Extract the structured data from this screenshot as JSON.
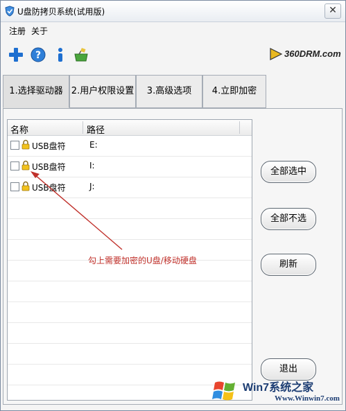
{
  "window": {
    "title": "U盘防拷贝系统(试用版)",
    "close_glyph": "✕"
  },
  "menu": {
    "items": [
      {
        "label": "注册"
      },
      {
        "label": "关于"
      }
    ]
  },
  "toolbar": {
    "icons": [
      "add-icon",
      "help-icon",
      "info-icon",
      "basket-icon"
    ]
  },
  "brand": {
    "text": "360DRM.com"
  },
  "tabs": [
    {
      "label": "1.选择驱动器",
      "active": true
    },
    {
      "label": "2.用户权限设置",
      "active": false
    },
    {
      "label": "3.高级选项",
      "active": false
    },
    {
      "label": "4.立即加密",
      "active": false
    }
  ],
  "drive_list": {
    "columns": {
      "name": "名称",
      "path": "路径"
    },
    "rows": [
      {
        "name": "USB盘符",
        "path": "E:",
        "checked": false
      },
      {
        "name": "USB盘符",
        "path": "I:",
        "checked": false
      },
      {
        "name": "USB盘符",
        "path": "J:",
        "checked": false
      }
    ]
  },
  "buttons": {
    "select_all": "全部选中",
    "select_none": "全部不选",
    "refresh": "刷新",
    "exit": "退出"
  },
  "annotation": {
    "text": "勾上需要加密的U盘/移动硬盘",
    "color": "#c0302a"
  },
  "watermark": {
    "title": "Win7系统之家",
    "url": "Www.Winwin7.com"
  },
  "colors": {
    "accent_blue": "#1e6fd0",
    "annotation_red": "#c0302a"
  }
}
